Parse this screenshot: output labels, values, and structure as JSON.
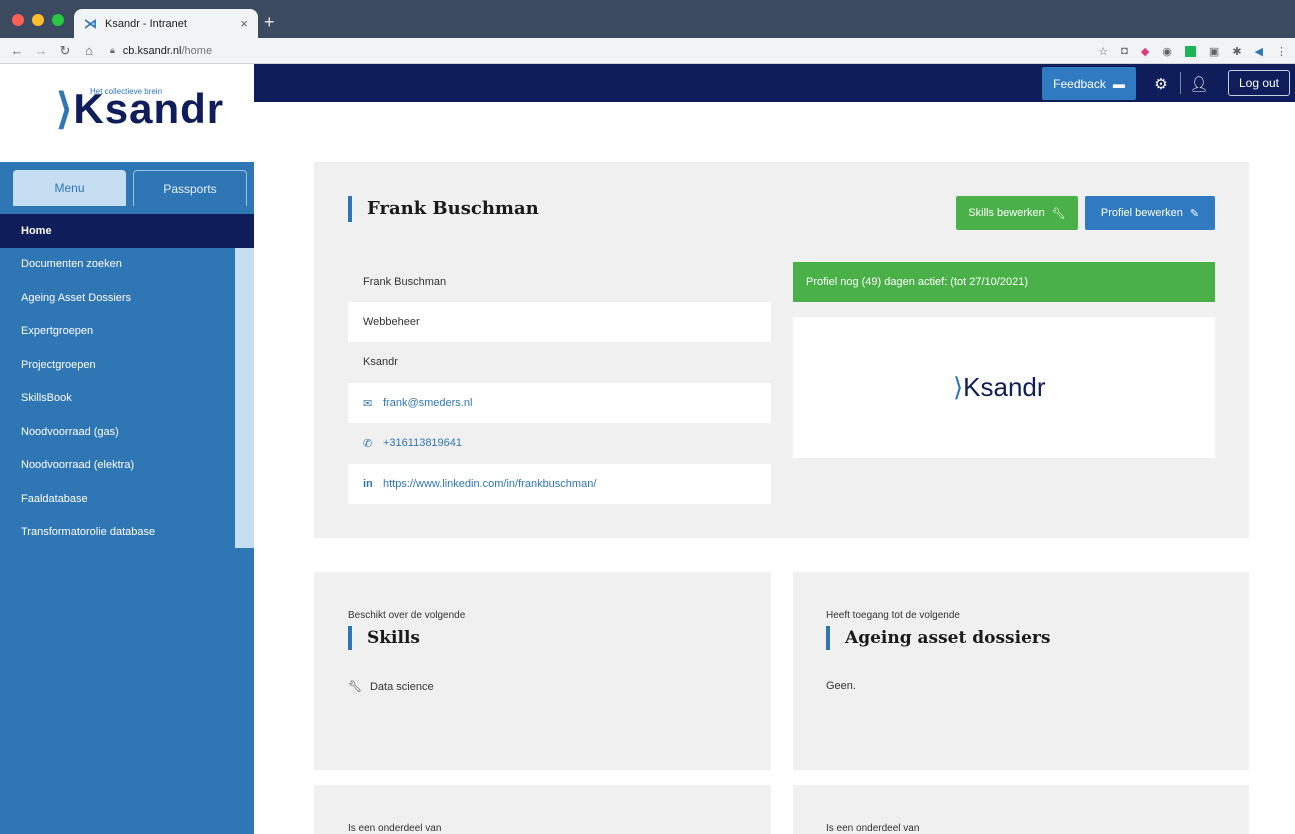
{
  "browser": {
    "tab_title": "Ksandr - Intranet",
    "tab_close": "×",
    "new_tab": "+",
    "url_host": "cb.ksandr.nl",
    "url_path": "/home"
  },
  "topnav": {
    "feedback_label": "Feedback",
    "logout_label": "Log out"
  },
  "sidebar": {
    "logo_text": "Ksandr",
    "logo_tagline": "Het collectieve brein",
    "tabs": [
      {
        "label": "Menu",
        "active": true
      },
      {
        "label": "Passports",
        "active": false
      }
    ],
    "items": [
      {
        "label": "Home",
        "active": true
      },
      {
        "label": "Documenten zoeken"
      },
      {
        "label": "Ageing Asset Dossiers"
      },
      {
        "label": "Expertgroepen"
      },
      {
        "label": "Projectgroepen"
      },
      {
        "label": "SkillsBook"
      },
      {
        "label": "Noodvoorraad (gas)"
      },
      {
        "label": "Noodvoorraad (elektra)"
      },
      {
        "label": "Faaldatabase"
      },
      {
        "label": "Transformatorolie database"
      }
    ]
  },
  "profile": {
    "name_heading": "Frank Buschman",
    "skills_button": "Skills bewerken",
    "edit_button": "Profiel bewerken",
    "rows": {
      "name": "Frank Buschman",
      "department": "Webbeheer",
      "organization": "Ksandr",
      "email": "frank@smeders.nl",
      "phone": "+316113819641",
      "linkedin": "https://www.linkedin.com/in/frankbuschman/"
    },
    "status": "Profiel nog (49) dagen actief:  (tot 27/10/2021)",
    "org_logo_text": "Ksandr"
  },
  "skills_card": {
    "sub": "Beschikt over de volgende",
    "title": "Skills",
    "items": [
      "Data science"
    ]
  },
  "dossiers_card": {
    "sub": "Heeft toegang tot de volgende",
    "title": "Ageing asset dossiers",
    "empty": "Geen."
  },
  "part_card_left": {
    "sub": "Is een onderdeel van"
  },
  "part_card_right": {
    "sub": "Is een onderdeel van"
  }
}
